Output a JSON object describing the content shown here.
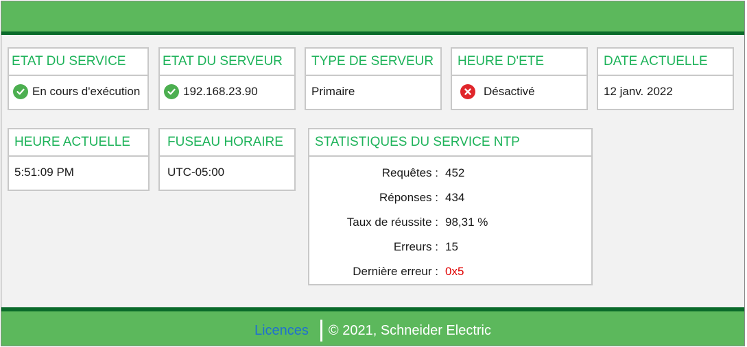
{
  "cards": {
    "service_state": {
      "title": "ETAT DU SERVICE",
      "value": "En cours d'exécution",
      "status": "ok"
    },
    "server_state": {
      "title": "ETAT DU SERVEUR",
      "value": "192.168.23.90",
      "status": "ok"
    },
    "server_type": {
      "title": "TYPE DE SERVEUR",
      "value": "Primaire"
    },
    "dst": {
      "title": "HEURE D'ETE",
      "value": "Désactivé",
      "status": "error"
    },
    "current_date": {
      "title": "DATE ACTUELLE",
      "value": "12 janv. 2022"
    },
    "current_time": {
      "title": "HEURE ACTUELLE",
      "value": "5:51:09 PM"
    },
    "timezone": {
      "title": "FUSEAU HORAIRE",
      "value": "UTC-05:00"
    }
  },
  "ntp_stats": {
    "title": "STATISTIQUES DU SERVICE NTP",
    "rows": [
      {
        "label": "Requêtes :",
        "value": "452"
      },
      {
        "label": "Réponses :",
        "value": "434"
      },
      {
        "label": "Taux de réussite :",
        "value": "98,31 %"
      },
      {
        "label": "Erreurs :",
        "value": "15"
      },
      {
        "label": "Dernière erreur :",
        "value": "0x5"
      }
    ]
  },
  "footer": {
    "licences": "Licences",
    "copyright": "© 2021, Schneider Electric"
  },
  "colors": {
    "header_green": "#5cb85c",
    "dark_green": "#0a6a2a",
    "title_green": "#1eb35a",
    "ok_icon": "#4caf50",
    "error_icon": "#e0262b",
    "error_text": "#e00000",
    "link_blue": "#1f6fd1"
  },
  "icons": {
    "ok": "check-circle-icon",
    "error": "x-circle-icon"
  }
}
